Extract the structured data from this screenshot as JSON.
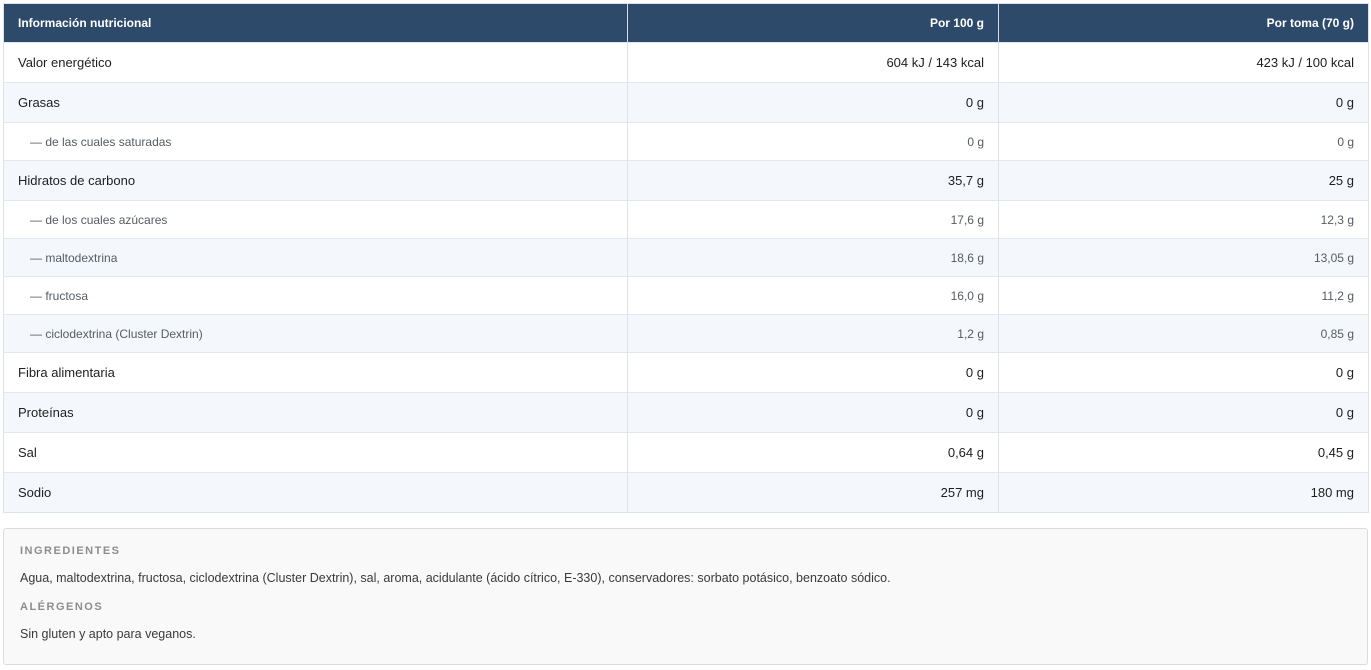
{
  "table": {
    "headers": [
      "Información nutricional",
      "Por 100 g",
      "Por toma (70 g)"
    ],
    "rows": [
      {
        "label": "Valor energético",
        "per100": "604 kJ / 143 kcal",
        "perServing": "423 kJ / 100 kcal"
      },
      {
        "label": "Grasas",
        "per100": "0 g",
        "perServing": "0 g"
      },
      {
        "label": "— de las cuales saturadas",
        "per100": "0 g",
        "perServing": "0 g"
      },
      {
        "label": "Hidratos de carbono",
        "per100": "35,7 g",
        "perServing": "25 g"
      },
      {
        "label": "— de los cuales azúcares",
        "per100": "17,6 g",
        "perServing": "12,3 g"
      },
      {
        "label": "— maltodextrina",
        "per100": "18,6 g",
        "perServing": "13,05 g"
      },
      {
        "label": "— fructosa",
        "per100": "16,0 g",
        "perServing": "11,2 g"
      },
      {
        "label": "— ciclodextrina (Cluster Dextrin)",
        "per100": "1,2 g",
        "perServing": "0,85 g"
      },
      {
        "label": "Fibra alimentaria",
        "per100": "0 g",
        "perServing": "0 g"
      },
      {
        "label": "Proteínas",
        "per100": "0 g",
        "perServing": "0 g"
      },
      {
        "label": "Sal",
        "per100": "0,64 g",
        "perServing": "0,45 g"
      },
      {
        "label": "Sodio",
        "per100": "257 mg",
        "perServing": "180 mg"
      }
    ]
  },
  "ingredients": {
    "title": "INGREDIENTES",
    "text": "Agua, maltodextrina, fructosa, ciclodextrina (Cluster Dextrin), sal, aroma, acidulante (ácido cítrico, E-330), conservadores: sorbato potásico, benzoato sódico."
  },
  "allergens": {
    "title": "ALÉRGENOS",
    "text": "Sin gluten y apto para veganos."
  },
  "colors": {
    "header_bg": "#2e4a6b",
    "header_text": "#ffffff",
    "alt_row": "#f4f8fc",
    "info_bg": "#f9f9f9"
  }
}
